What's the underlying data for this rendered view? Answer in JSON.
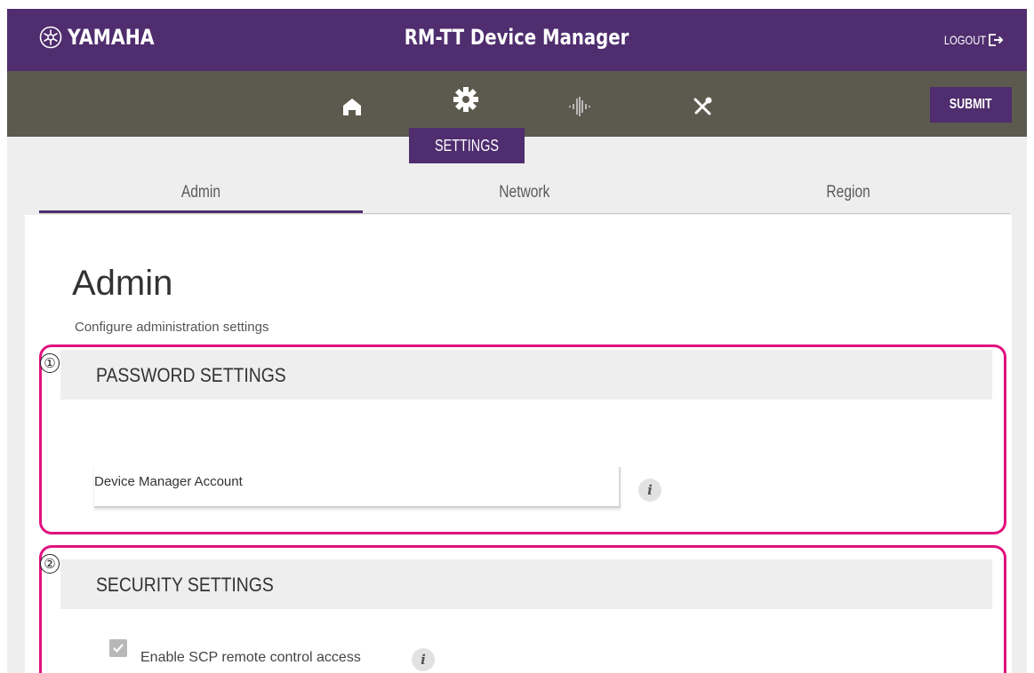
{
  "header": {
    "brand": "YAMAHA",
    "title": "RM-TT Device Manager",
    "logout_label": "LOGOUT"
  },
  "toolbar": {
    "icons": [
      "home-icon",
      "gear-icon",
      "audio-waveform-icon",
      "tools-icon"
    ],
    "submit_label": "SUBMIT",
    "active_section": "SETTINGS"
  },
  "tabs": [
    {
      "label": "Admin",
      "active": true
    },
    {
      "label": "Network",
      "active": false
    },
    {
      "label": "Region",
      "active": false
    }
  ],
  "main": {
    "title": "Admin",
    "subtitle": "Configure administration settings",
    "sections": [
      {
        "number": "①",
        "title": "PASSWORD SETTINGS",
        "field_label": "Device Manager Account"
      },
      {
        "number": "②",
        "title": "SECURITY SETTINGS",
        "checkbox_label": "Enable SCP remote control access",
        "checkbox_checked": true
      }
    ]
  },
  "colors": {
    "header": "#4f2d6e",
    "toolbar": "#5c5a4e",
    "callout": "#e0117f",
    "background": "#eeeeee"
  }
}
